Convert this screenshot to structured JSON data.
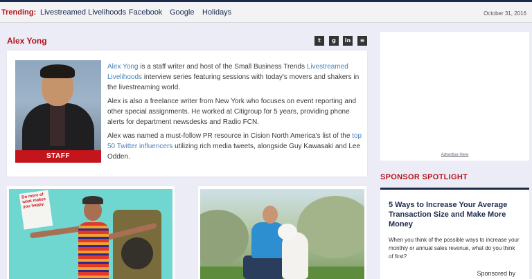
{
  "trending": {
    "label": "Trending:",
    "links": [
      "Livestreamed Livelihoods",
      "Facebook",
      "Google",
      "Holidays"
    ],
    "date": "October 31, 2016"
  },
  "author": {
    "name": "Alex Yong",
    "social_icons": [
      "twitter-icon",
      "google-plus-icon",
      "linkedin-icon",
      "rss-icon"
    ],
    "photo_badge": "STAFF",
    "bio": {
      "p1": {
        "link1": "Alex Yong",
        "text1": " is a staff writer and host of the Small Business Trends ",
        "link2": "Livestreamed Livelihoods",
        "text2": " interview series featuring sessions with today's movers and shakers in the livestreaming world."
      },
      "p2": "Alex is also a freelance writer from New York who focuses on event reporting and other special assignments. He worked at Citigroup for 5 years, providing phone alerts for department newsdesks and Radio FCN.",
      "p3": {
        "text1": "Alex was named a must-follow PR resource in Cision North America's list of the ",
        "link": "top 50 Twitter influencers",
        "text2": " utilizing rich media tweets, alongside Guy Kawasaki and Lee Odden."
      }
    }
  },
  "ad": {
    "link": "Advertise Here"
  },
  "sponsor": {
    "title": "SPONSOR SPOTLIGHT",
    "headline": "5 Ways to Increase Your Average Transaction Size and Make More Money",
    "body": "When you think of the possible ways to increase your monthly or annual sales revenue, what do you think of first?",
    "byline": "Sponsored by"
  },
  "cards": {
    "sign_text": "Do more of what makes you happy."
  }
}
